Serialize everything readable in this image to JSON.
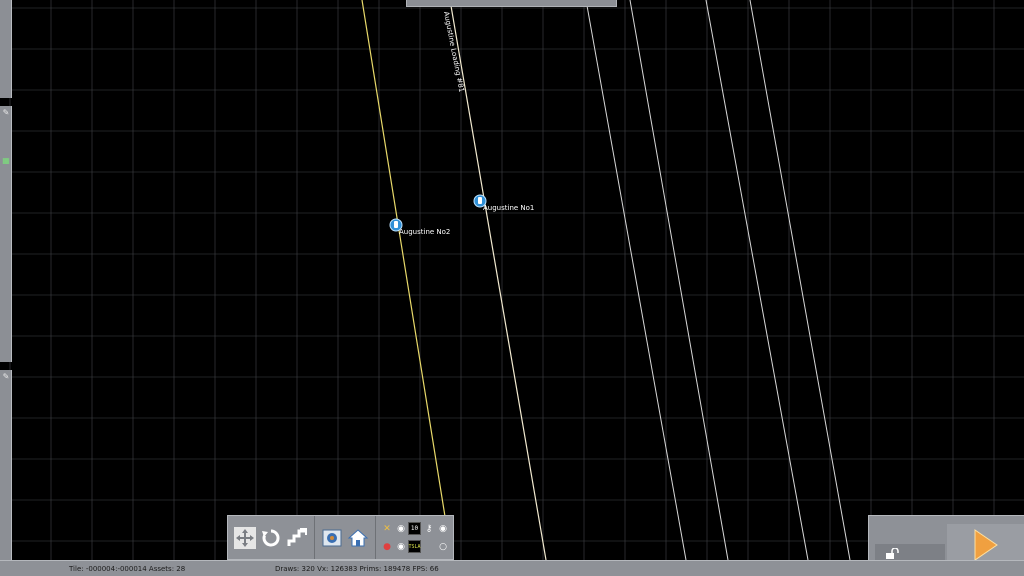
{
  "map": {
    "industry_markers": [
      {
        "name": "Augustine No2",
        "icon": "industry-location-icon"
      },
      {
        "name": "Augustine No1",
        "icon": "industry-location-icon"
      }
    ],
    "track_label": "Augustine Loading #81"
  },
  "toolbar": {
    "buttons": [
      {
        "name": "move-tool",
        "icon": "move-arrows-icon"
      },
      {
        "name": "rotate-tool",
        "icon": "rotate-icon"
      },
      {
        "name": "stairs-tool",
        "icon": "stairs-icon"
      },
      {
        "name": "camera-view",
        "icon": "camera-icon"
      },
      {
        "name": "home-view",
        "icon": "home-icon"
      }
    ],
    "speed_value": "10",
    "signal_value": "TSLA"
  },
  "status": {
    "tile_info": "Tile: -000004:-000014  Assets: 28",
    "render_stats": "Draws: 320 Vx: 126383 Prims: 189478 FPS: 66"
  },
  "colors": {
    "background": "#000000",
    "grid": "#5f6268",
    "track_main": "#e8d96a",
    "track_white": "#d8d8d8",
    "panel": "#8e9197",
    "marker": "#2f8fd6",
    "play_arrow": "#f0a040"
  }
}
